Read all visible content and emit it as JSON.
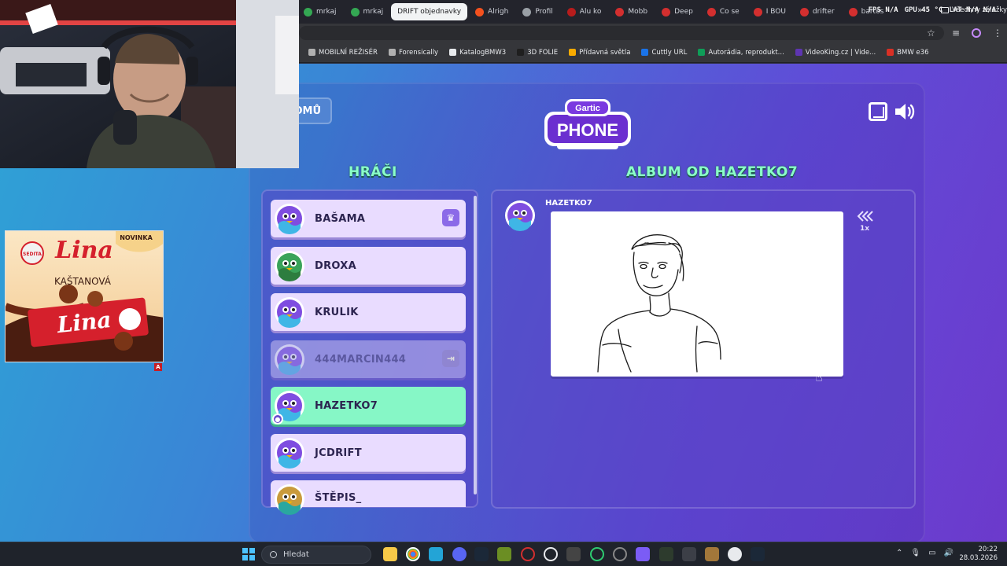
{
  "browser": {
    "tabs": [
      {
        "label": "mrkaj",
        "color": "#34a853"
      },
      {
        "label": "mrkaj",
        "color": "#34a853"
      },
      {
        "label": "DRIFT objednavky",
        "color": "#000000",
        "active": true
      },
      {
        "label": "Alrigh",
        "color": "#f4511e"
      },
      {
        "label": "Profil",
        "color": "#9aa0a6"
      },
      {
        "label": "Alu ko",
        "color": "#b71c1c"
      },
      {
        "label": "Mobb",
        "color": "#d32f2f"
      },
      {
        "label": "Deep",
        "color": "#d32f2f"
      },
      {
        "label": "Co se",
        "color": "#d32f2f"
      },
      {
        "label": "I BOU",
        "color": "#d32f2f"
      },
      {
        "label": "drifter",
        "color": "#d32f2f"
      },
      {
        "label": "bartos",
        "color": "#d32f2f"
      }
    ],
    "metrics": {
      "fps_label": "FPS",
      "fps_value": "N/A",
      "gpu_label": "GPU",
      "gpu_value": "45 °C",
      "lat_label": "LAT",
      "lat_value1": "N/A",
      "lat_value2": "N/A"
    },
    "bookmarks": [
      {
        "label": "MOBILNÍ REŽISÉR",
        "color": "#b0b0b0"
      },
      {
        "label": "Forensically",
        "color": "#b0b0b0"
      },
      {
        "label": "KatalogBMW3",
        "color": "#e8eaed"
      },
      {
        "label": "3D FOLIE",
        "color": "#1f1f1f"
      },
      {
        "label": "Přídavná světla",
        "color": "#f9ab00"
      },
      {
        "label": "Cuttly URL",
        "color": "#1a73e8"
      },
      {
        "label": "Autorádia, reprodukt...",
        "color": "#0f9d58"
      },
      {
        "label": "VideoKing.cz | Vide...",
        "color": "#5e35b1"
      },
      {
        "label": "BMW e36",
        "color": "#d93025"
      }
    ],
    "all_bookmarks": "Všechny záložky"
  },
  "game": {
    "back_label": "OMŮ",
    "logo_top": "Gartic",
    "logo_bottom": "PHONE",
    "players_heading": "HRÁČI",
    "album_heading": "ALBUM OD HAZETKO7",
    "players": [
      {
        "name": "BAŠAMA",
        "state": "normal",
        "avatar": "purple",
        "badge": "♛"
      },
      {
        "name": "DROXA",
        "state": "normal",
        "avatar": "green"
      },
      {
        "name": "KRULIK",
        "state": "normal",
        "avatar": "purple"
      },
      {
        "name": "444MARCIN444",
        "state": "away",
        "avatar": "purple",
        "badge": "⇥"
      },
      {
        "name": "HAZETKO7",
        "state": "current",
        "avatar": "purple"
      },
      {
        "name": "JCDRIFT",
        "state": "normal",
        "avatar": "purple"
      },
      {
        "name": "ŠTĚPIS_",
        "state": "normal",
        "avatar": "gold"
      }
    ],
    "album": {
      "author": "HAZETKO7",
      "speed": "1x"
    }
  },
  "ad": {
    "brand": "Lina",
    "flavor": "KAŠTANOVÁ",
    "tag": "NOVINKA",
    "maker": "SEDITA",
    "badge": "A"
  },
  "taskbar": {
    "search_placeholder": "Hledat",
    "time": "20:22",
    "date": "28.03.2026"
  }
}
